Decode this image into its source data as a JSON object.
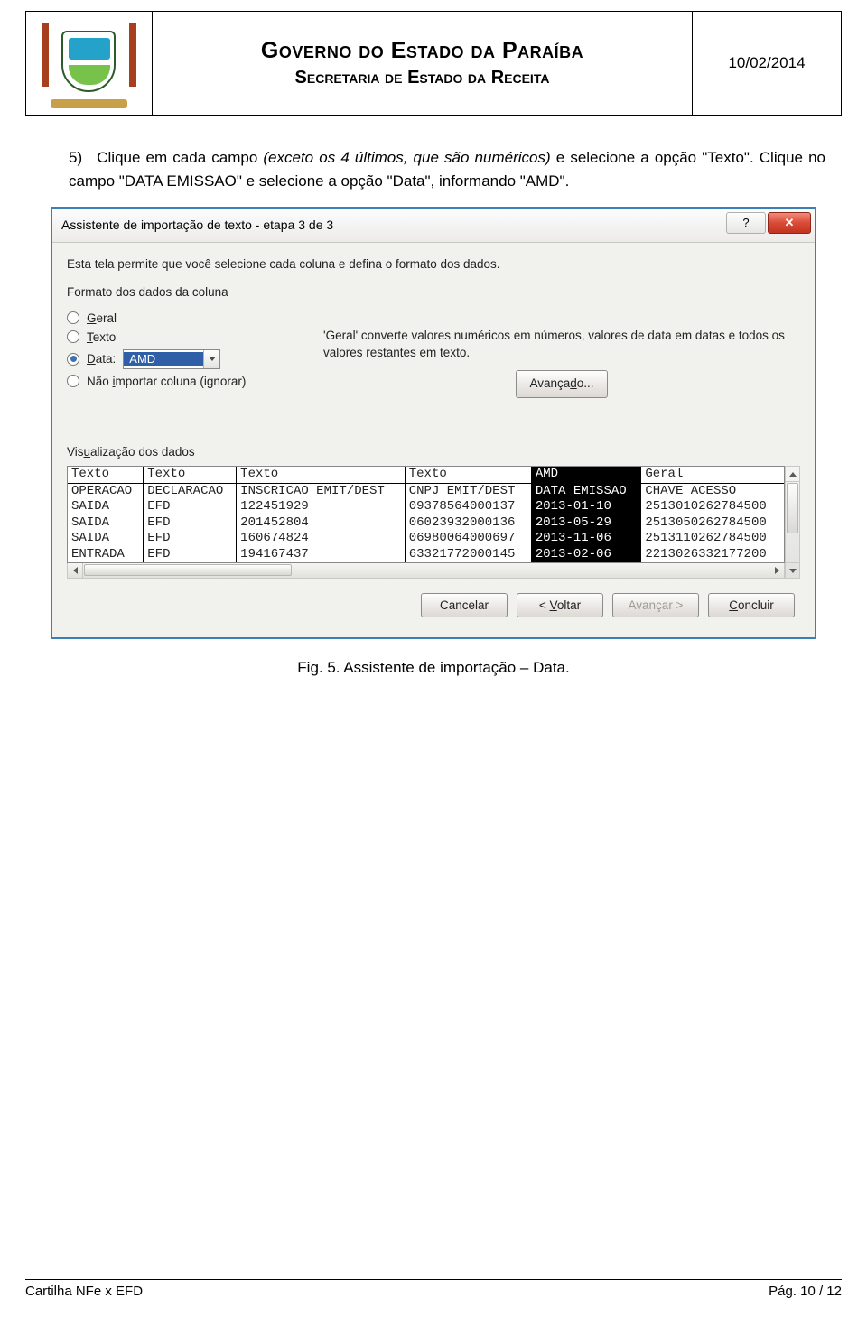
{
  "header": {
    "line1": "Governo do Estado da Paraíba",
    "line2": "Secretaria de Estado da Receita",
    "date": "10/02/2014"
  },
  "body": {
    "item_num": "5)",
    "para_part1": "Clique em cada campo ",
    "para_italic": "(exceto os 4 últimos, que são numéricos)",
    "para_part2": " e selecione a opção \"Texto\". Clique no campo \"DATA EMISSAO\" e selecione a opção \"Data\", informando \"AMD\"."
  },
  "dialog": {
    "title": "Assistente de importação de texto - etapa 3 de 3",
    "help_icon_label": "?",
    "close_icon_label": "✕",
    "lead": "Esta tela permite que você selecione cada coluna e defina o formato dos dados.",
    "group_label": "Formato dos dados da coluna",
    "radio_general": "Geral",
    "radio_text": "Texto",
    "radio_date": "Data:",
    "radio_skip": "Não importar coluna (ignorar)",
    "date_format": "AMD",
    "desc": "'Geral' converte valores numéricos em números, valores de data em datas e todos os valores restantes em texto.",
    "adv_btn": "Avançado...",
    "viz_label": "Visualização dos dados",
    "preview": {
      "header": [
        "Texto",
        "Texto",
        "Texto",
        "Texto",
        "AMD",
        "Geral"
      ],
      "row1": [
        "OPERACAO",
        "DECLARACAO",
        "INSCRICAO EMIT/DEST",
        "CNPJ EMIT/DEST",
        "DATA EMISSAO",
        "CHAVE ACESSO"
      ],
      "rows": [
        [
          "SAIDA",
          "EFD",
          "122451929",
          "09378564000137",
          "2013-01-10",
          "2513010262784500"
        ],
        [
          "SAIDA",
          "EFD",
          "201452804",
          "06023932000136",
          "2013-05-29",
          "2513050262784500"
        ],
        [
          "SAIDA",
          "EFD",
          "160674824",
          "06980064000697",
          "2013-11-06",
          "2513110262784500"
        ],
        [
          "ENTRADA",
          "EFD",
          "194167437",
          "63321772000145",
          "2013-02-06",
          "2213026332177200"
        ]
      ]
    },
    "btn_cancel": "Cancelar",
    "btn_back": "< Voltar",
    "btn_next": "Avançar >",
    "btn_finish": "Concluir"
  },
  "figcap": "Fig. 5. Assistente de importação – Data.",
  "footer": {
    "left": "Cartilha NFe x EFD",
    "right": "Pág. 10 / 12"
  }
}
